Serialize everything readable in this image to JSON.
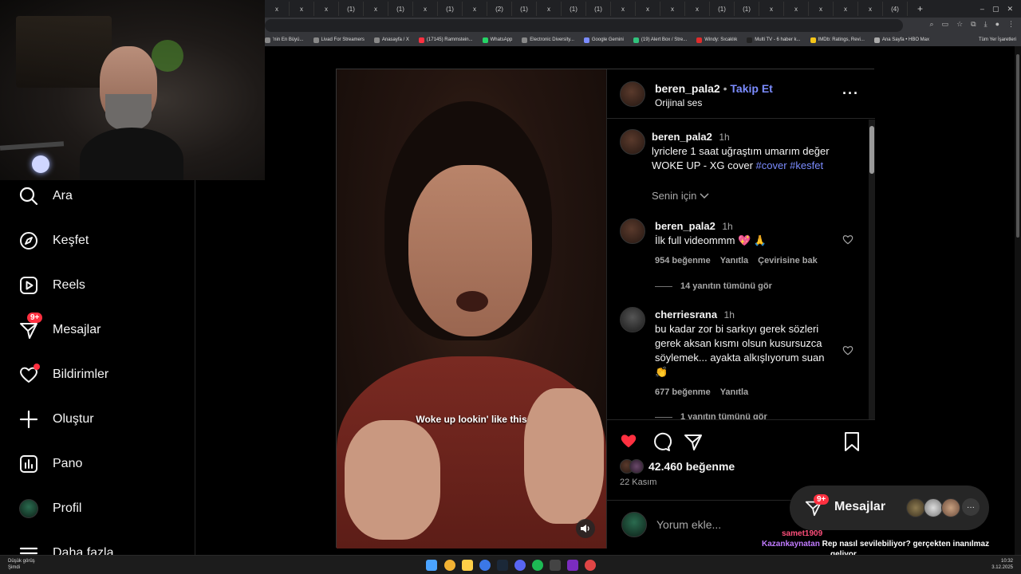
{
  "browser": {
    "tabs": [
      "x",
      "x",
      "x",
      "(1)",
      "x",
      "(1)",
      "x",
      "(1)",
      "x",
      "(2)",
      "(1)",
      "x",
      "(1)",
      "(1)",
      "x",
      "x",
      "x",
      "x",
      "(1)",
      "(1)",
      "x",
      "x",
      "x",
      "x",
      "x",
      "(4)"
    ],
    "new_tab": "+",
    "bookmarks": [
      "'nin En Büyü...",
      "Livad For Streamers",
      "Anasayfa / X",
      "(17145) Rammstein...",
      "WhatsApp",
      "Electronic Diversity...",
      "Google Gemini",
      "(19) Alert Box / Stre...",
      "Windy: Sıcaklık",
      "Multi TV - 6 haber k...",
      "IMDb: Ratings, Revi...",
      "Ana Sayfa • HBO Max"
    ],
    "all_bookmarks": "Tüm Yer İşaretleri",
    "window_controls": [
      "–",
      "▢",
      "✕"
    ]
  },
  "nav": {
    "items": [
      {
        "label": "Ara",
        "icon": "search-icon"
      },
      {
        "label": "Keşfet",
        "icon": "compass-icon"
      },
      {
        "label": "Reels",
        "icon": "reels-icon"
      },
      {
        "label": "Mesajlar",
        "icon": "messenger-icon",
        "badge": "9+"
      },
      {
        "label": "Bildirimler",
        "icon": "heart-icon"
      },
      {
        "label": "Oluştur",
        "icon": "plus-icon"
      },
      {
        "label": "Pano",
        "icon": "dashboard-icon"
      },
      {
        "label": "Profil",
        "icon": "avatar-icon"
      },
      {
        "label": "Daha fazla",
        "icon": "menu-icon"
      }
    ]
  },
  "post": {
    "video_caption": "Woke up lookin' like this",
    "author": "beren_pala2",
    "follow_sep": "•",
    "follow": "Takip Et",
    "audio": "Orijinal ses",
    "caption": {
      "user": "beren_pala2",
      "time": "1h",
      "text_line1": "lyriclere 1 saat uğraştım umarım değer",
      "text_line2_prefix": "WOKE UP - XG cover ",
      "hashtag1": "#cover",
      "hashtag2": "#kesfet"
    },
    "senin_icin": "Senin için",
    "comments": [
      {
        "user": "beren_pala2",
        "time": "1h",
        "text": "İlk full videommm 💖 🙏",
        "likes": "954 beğenme",
        "reply": "Yanıtla",
        "translate": "Çevirisine bak",
        "view_replies": "14 yanıtın tümünü gör"
      },
      {
        "user": "cherriesrana",
        "time": "1h",
        "text_lines": [
          "bu kadar zor bi sarkıyı gerek sözleri",
          "gerek aksan kısmı olsun kusursuzca",
          "söylemek... ayakta alkışlıyorum suan",
          "👏"
        ],
        "likes": "677 beğenme",
        "reply": "Yanıtla",
        "view_replies": "1 yanıtın tümünü gör"
      }
    ],
    "likes": "42.460 beğenme",
    "date": "22 Kasım",
    "add_comment_placeholder": "Yorum ekle..."
  },
  "messages_pill": {
    "label": "Mesajlar",
    "badge": "9+",
    "more": "···"
  },
  "chat_overlay": {
    "user1": "samet1909",
    "user2": "Kazankaynatan",
    "message_line1": "Rep nasıl sevilebiliyor? gerçekten inanılmaz",
    "message_line2": "geliyor."
  },
  "taskbar": {
    "weather_line1": "Düşük görüş",
    "weather_line2": "Şimdi",
    "time": "10:32",
    "date": "3.12.2025"
  },
  "colors": {
    "accent_blue": "#7b8cff",
    "like_red": "#ff3040",
    "bg": "#000000"
  }
}
